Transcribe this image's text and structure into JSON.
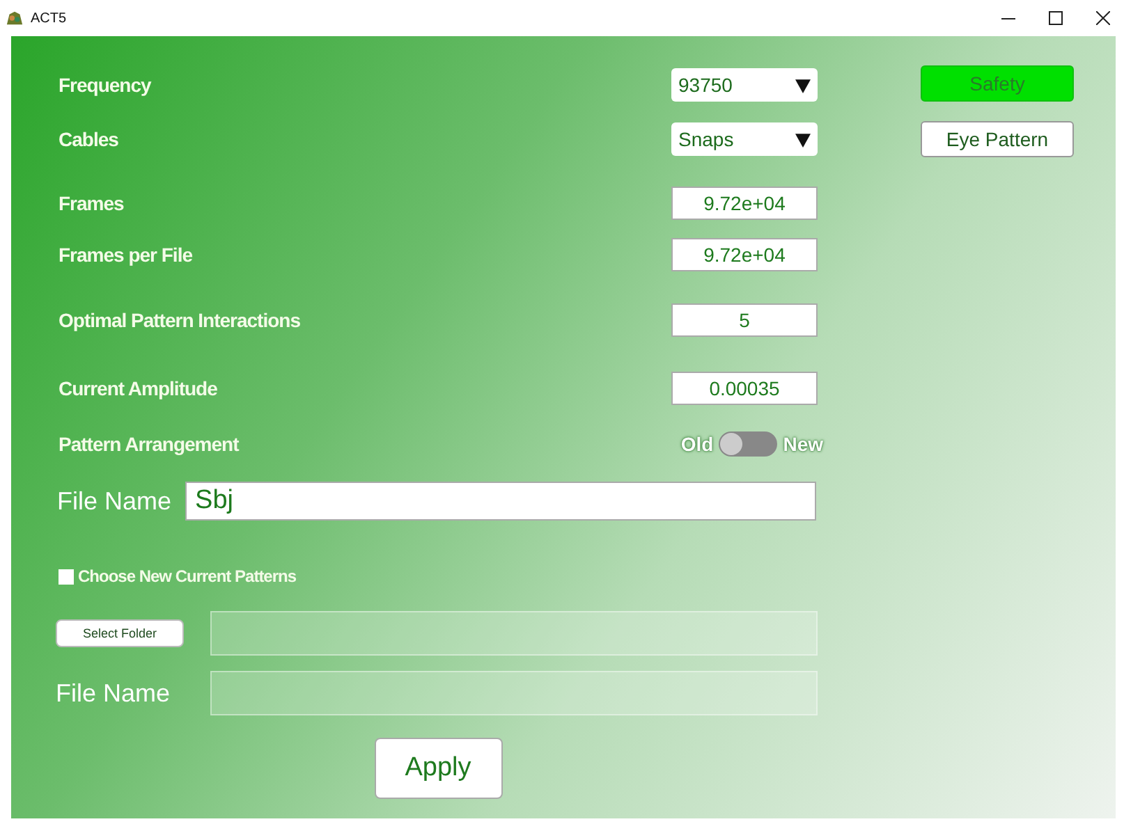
{
  "window": {
    "title": "ACT5"
  },
  "settings": [
    {
      "label": "Frequency",
      "kind": "dropdown",
      "value": "93750"
    },
    {
      "label": "Cables",
      "kind": "dropdown",
      "value": "Snaps"
    },
    {
      "label": "Frames",
      "kind": "number",
      "value": "9.72e+04"
    },
    {
      "label": "Frames per File",
      "kind": "number",
      "value": "9.72e+04"
    },
    {
      "label": "Optimal Pattern Interactions",
      "kind": "number",
      "value": "5"
    },
    {
      "label": "Current Amplitude",
      "kind": "number",
      "value": "0.00035"
    },
    {
      "label": "Pattern Arrangement",
      "kind": "toggle",
      "off_label": "Old",
      "on_label": "New",
      "on": false
    }
  ],
  "side_buttons": [
    {
      "label": "Safety",
      "kind": "highlight"
    },
    {
      "label": "Eye Pattern",
      "kind": "plain"
    }
  ],
  "file_name": {
    "label": "File Name",
    "value": "Sbj"
  },
  "patterns": {
    "label": "Choose New Current Patterns",
    "checked": false,
    "folder_button": "Select Folder",
    "file_label": "File Name",
    "disabled": true
  },
  "apply_button": "Apply"
}
